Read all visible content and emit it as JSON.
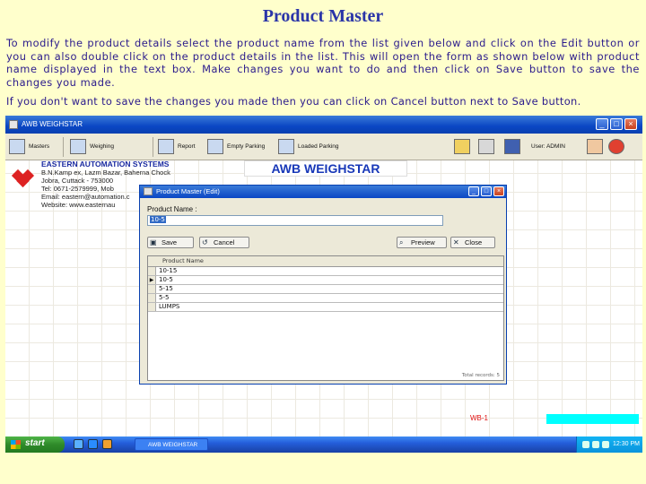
{
  "title": "Product Master",
  "instructions": {
    "para1": "To modify the product details select the product name from the list given below and click on the Edit button or you can also double click on the product details in the list. This will open the form as shown below with product name displayed in the text box. Make changes you want to do and then click on Save button to save the changes you made.",
    "para2": "If you don't want to save the changes you made then you can click on Cancel button next to Save button."
  },
  "app": {
    "window_title": "AWB WEIGHSTAR",
    "toolbar": {
      "masters": "Masters",
      "weighing": "Weighing",
      "report": "Report",
      "empty_parking": "Empty Parking",
      "loaded_parking": "Loaded Parking",
      "user": "User: ADMIN"
    },
    "company": {
      "name": "EASTERN AUTOMATION SYSTEMS",
      "line1": "B.N.Kamp ex, Lazm Bazar, Baherna Chock",
      "line2": "Jobra, Cuttack - 753000",
      "line3": "Tel: 0671-2579999, Mob",
      "line4": "Email: eastern@automation.c",
      "line5": "Website: www.easternau"
    },
    "brand": "AWB WEIGHSTAR",
    "dialog": {
      "title": "Product Master (Edit)",
      "label": "Product Name :",
      "input_value": "10-5",
      "save": "Save",
      "cancel": "Cancel",
      "preview": "Preview",
      "close": "Close",
      "grid_header": "Product Name",
      "rows": [
        "10-15",
        "10-5",
        "5-15",
        "5-5",
        "LUMPS"
      ],
      "grid_footer": "Total records: 5"
    },
    "status_code": "WB-1",
    "taskbar": {
      "start": "start",
      "task": "AWB WEIGHSTAR",
      "clock": "12:30 PM"
    }
  }
}
